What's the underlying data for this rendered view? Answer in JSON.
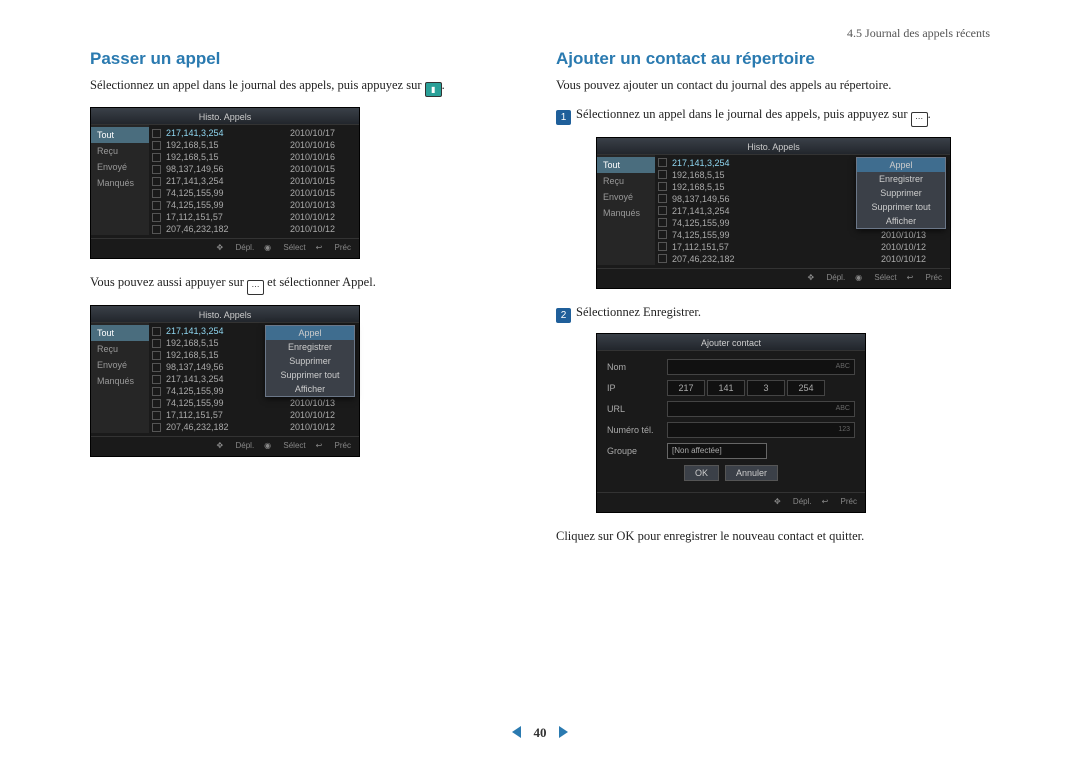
{
  "breadcrumb": "4.5 Journal des appels récents",
  "page_num": "40",
  "left": {
    "heading": "Passer un appel",
    "p1a": "Sélectionnez un appel dans le journal des appels, puis appuyez sur ",
    "p1b": ".",
    "p2a": "Vous pouvez aussi appuyer sur ",
    "p2b": " et sélectionner Appel."
  },
  "right": {
    "heading": "Ajouter un contact au répertoire",
    "p1": "Vous pouvez ajouter un contact du journal des appels au répertoire.",
    "s1a": "Sélectionnez un appel dans le journal des appels, puis appuyez sur ",
    "s1b": ".",
    "s2": "Sélectionnez Enregistrer.",
    "p2": "Cliquez sur OK pour enregistrer le nouveau contact et quitter."
  },
  "screen": {
    "title": "Histo. Appels",
    "tabs": [
      "Tout",
      "Reçu",
      "Envoyé",
      "Manqués"
    ],
    "rows": [
      {
        "ip": "217,141,3,254",
        "date": "2010/10/17",
        "hl": true
      },
      {
        "ip": "192,168,5,15",
        "date": "2010/10/16"
      },
      {
        "ip": "192,168,5,15",
        "date": "2010/10/16"
      },
      {
        "ip": "98,137,149,56",
        "date": "2010/10/15"
      },
      {
        "ip": "217,141,3,254",
        "date": "2010/10/15"
      },
      {
        "ip": "74,125,155,99",
        "date": "2010/10/15"
      },
      {
        "ip": "74,125,155,99",
        "date": "2010/10/13"
      },
      {
        "ip": "17,112,151,57",
        "date": "2010/10/12"
      },
      {
        "ip": "207,46,232,182",
        "date": "2010/10/12"
      }
    ],
    "rows_short": [
      {
        "ip": "217,141,3,254",
        "date": "",
        "hl": true
      },
      {
        "ip": "192,168,5,15",
        "date": ""
      },
      {
        "ip": "192,168,5,15",
        "date": ""
      },
      {
        "ip": "98,137,149,56",
        "date": ""
      },
      {
        "ip": "217,141,3,254",
        "date": ""
      },
      {
        "ip": "74,125,155,99",
        "date": ""
      },
      {
        "ip": "74,125,155,99",
        "date": "2010/10/13"
      },
      {
        "ip": "17,112,151,57",
        "date": "2010/10/12"
      },
      {
        "ip": "207,46,232,182",
        "date": "2010/10/12"
      }
    ],
    "foot": {
      "move": "Dépl.",
      "select": "Sélect",
      "back": "Préc"
    }
  },
  "popup": {
    "title": "Appel",
    "items": [
      "Enregistrer",
      "Supprimer",
      "Supprimer tout",
      "Afficher"
    ]
  },
  "contact": {
    "title": "Ajouter contact",
    "labels": {
      "name": "Nom",
      "ip": "IP",
      "url": "URL",
      "tel": "Numéro tél.",
      "group": "Groupe"
    },
    "ip": [
      "217",
      "141",
      "3",
      "254"
    ],
    "group_val": "[Non affectée]",
    "suffix": {
      "abc": "ABC",
      "num": "123"
    },
    "ok": "OK",
    "cancel": "Annuler",
    "foot": {
      "move": "Dépl.",
      "back": "Préc"
    }
  }
}
